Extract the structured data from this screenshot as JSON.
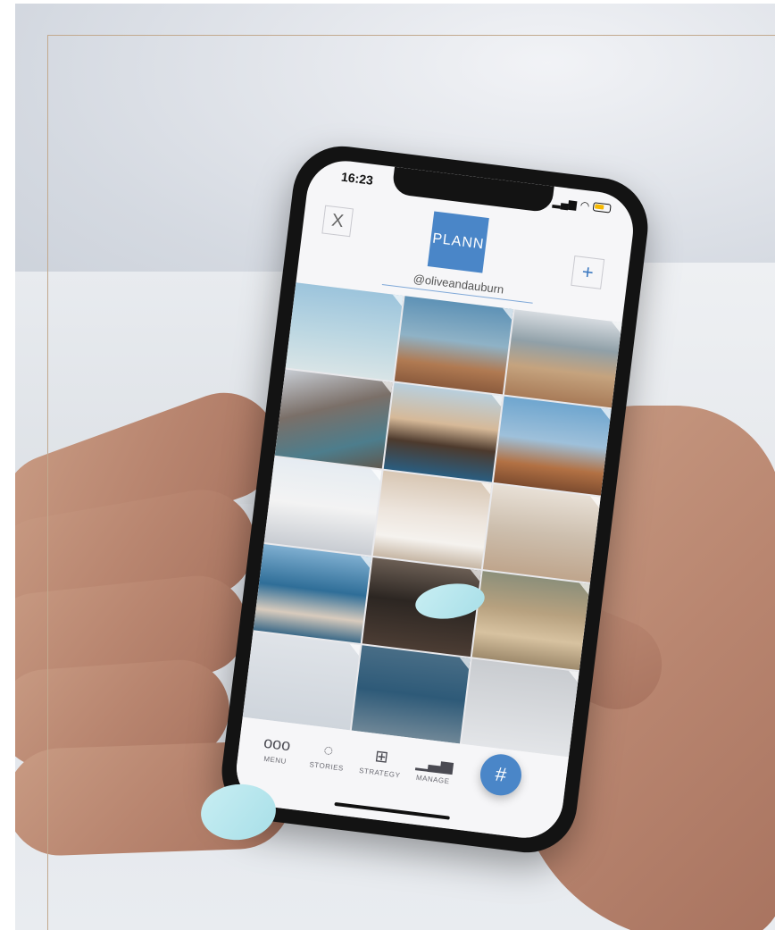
{
  "phone": {
    "status_time": "16:23",
    "logo_text": "PLANN",
    "close_label": "X",
    "add_label": "+",
    "handle": "@oliveandauburn"
  },
  "bottom_nav": {
    "menu_icon": "ooo",
    "menu_label": "MENU",
    "stories_label": "STORIES",
    "strategy_label": "STRATEGY",
    "manage_label": "MANAGE",
    "hashtag_label": "#"
  },
  "colors": {
    "brand_blue": "#4a86c8",
    "frame_gold": "#c2a98e",
    "nail_blue": "#a8dfe8"
  }
}
